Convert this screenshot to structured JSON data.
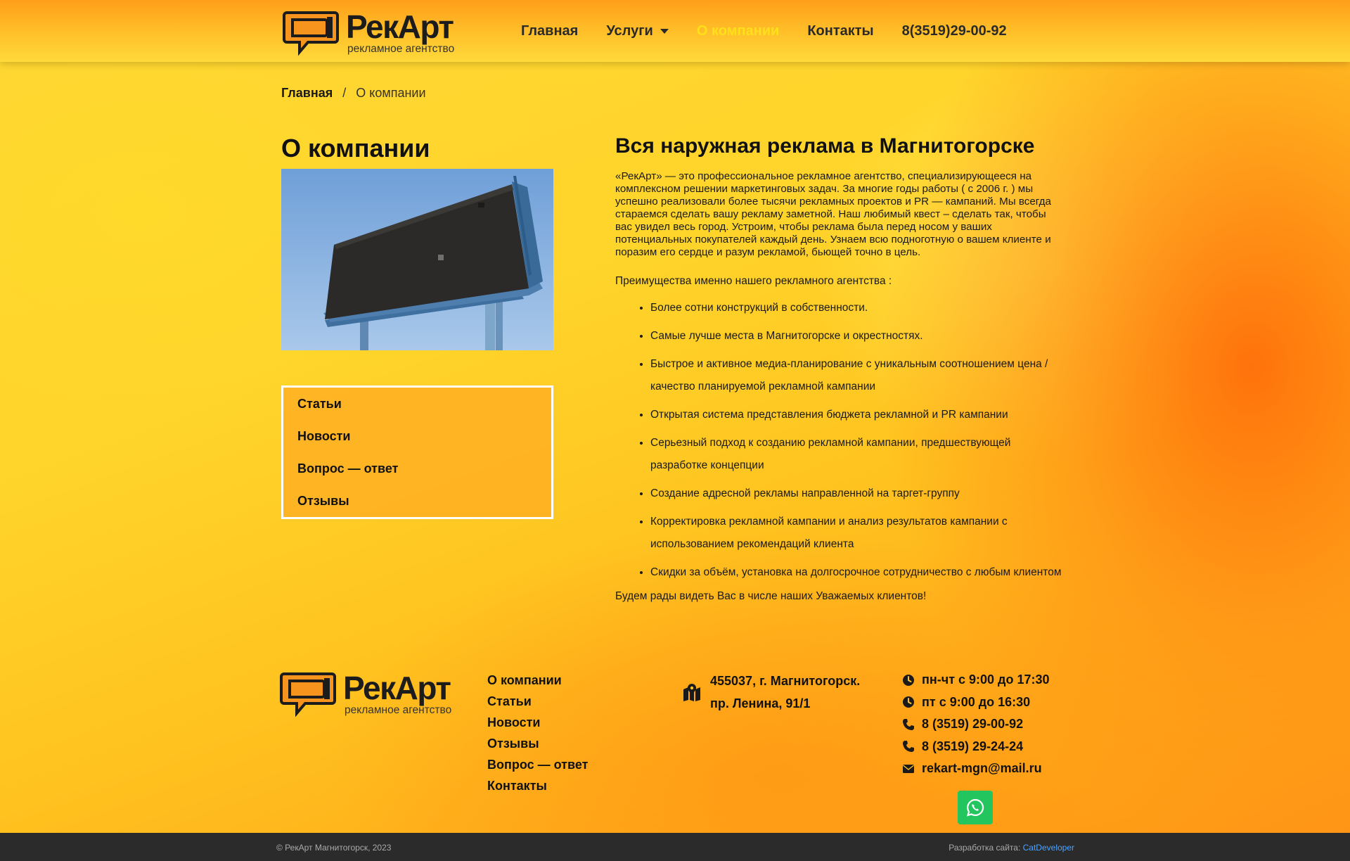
{
  "header": {
    "logo_name": "РекАрт",
    "logo_tagline": "рекламное агентство",
    "nav": {
      "home": "Главная",
      "services": "Услуги",
      "about": "О компании",
      "contacts": "Контакты",
      "phone": "8(3519)29-00-92"
    }
  },
  "breadcrumb": {
    "home": "Главная",
    "separator": "/",
    "current": "О компании"
  },
  "sidebar": {
    "title": "О компании",
    "menu": [
      "Статьи",
      "Новости",
      "Вопрос — ответ",
      "Отзывы"
    ]
  },
  "content": {
    "title": "Вся наружная реклама в Магнитогорске",
    "intro": "«РекАрт»  — это профессиональное рекламное агентство, специализирующееся на комплексном решении маркетинговых задач. За многие годы работы ( с 2006 г. ) мы успешно реализовали более тысячи рекламных проектов  и PR — кампаний. Мы всегда стараемся сделать вашу рекламу заметной. Наш любимый квест – сделать так, чтобы вас увидел весь город. Устроим, чтобы реклама была перед носом у ваших потенциальных покупателей каждый день. Узнаем всю подноготную о вашем клиенте и поразим его сердце и разум рекламой, бьющей точно в цель.",
    "advantages_title": "Преимущества именно нашего рекламного агентства :",
    "advantages": [
      "Более сотни конструкций в собственности.",
      "Самые лучше места в Магнитогорске и окрестностях.",
      "Быстрое и активное медиа-планирование с уникальным соотношением цена / качество планируемой рекламной кампании",
      "Открытая система представления бюджета рекламной и PR кампании",
      "Серьезный подход к созданию рекламной кампании, предшествующей разработке концепции",
      "Создание адресной рекламы направленной на таргет-группу",
      "Корректировка рекламной кампании и анализ результатов кампании с использованием рекомендаций клиента",
      "Скидки за объём, установка на долгосрочное сотрудничество с любым клиентом"
    ],
    "closing": "Будем рады видеть Вас в числе наших Уважаемых клиентов!"
  },
  "footer": {
    "links": [
      "О компании",
      "Статьи",
      "Новости",
      "Отзывы",
      "Вопрос — ответ",
      "Контакты"
    ],
    "address_line1": "455037, г. Магнитогорск.",
    "address_line2": "пр. Ленина, 91/1",
    "hours_1": "пн-чт с 9:00 до 17:30",
    "hours_2": "пт с 9:00 до 16:30",
    "phone_1": "8 (3519) 29-00-92",
    "phone_2": "8 (3519) 29-24-24",
    "email": "rekart-mgn@mail.ru",
    "copyright": "© РекАрт Магнитогорск, 2023",
    "dev_label": "Разработка сайта:",
    "dev_name": "CatDeveloper"
  },
  "colors": {
    "accent": "#ffe01a",
    "whatsapp": "#22c55e",
    "bottom_bar": "#2b2b2b",
    "link": "#4aa3ff"
  },
  "icons": [
    "logo-speech-bubble-icon",
    "caret-down-icon",
    "map-icon",
    "clock-icon",
    "phone-icon",
    "envelope-icon",
    "whatsapp-icon"
  ]
}
